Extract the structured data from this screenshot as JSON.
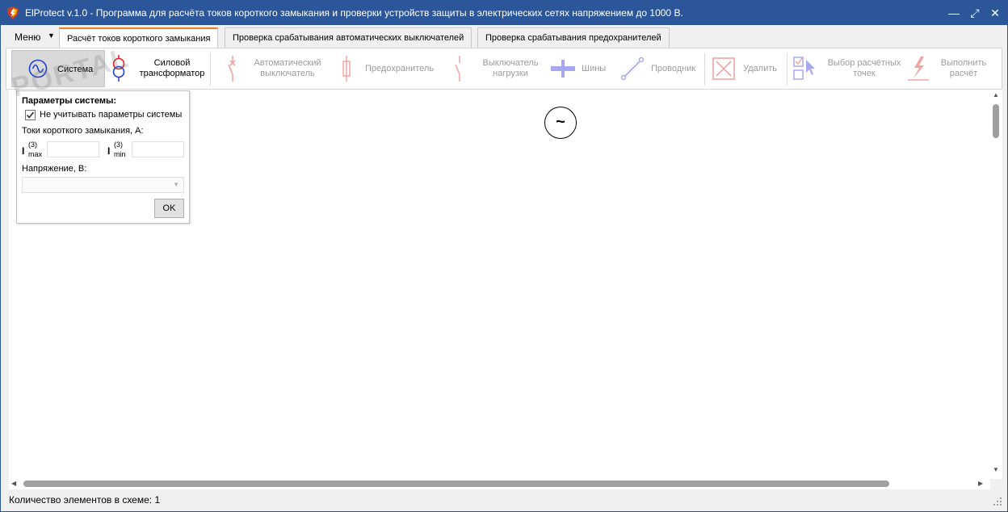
{
  "window": {
    "title": "ElProtect v.1.0 - Программа для расчёта токов короткого замыкания и проверки устройств защиты в электрических сетях напряжением до 1000 В.",
    "controls": {
      "minimize": "—",
      "maximize": "⤢",
      "close": "✕"
    }
  },
  "menu": {
    "label": "Меню",
    "arrow": "▼"
  },
  "tabs": [
    {
      "label": "Расчёт токов короткого замыкания",
      "active": true
    },
    {
      "label": "Проверка срабатывания автоматических выключателей",
      "active": false
    },
    {
      "label": "Проверка срабатывания предохранителей",
      "active": false
    }
  ],
  "ribbon": {
    "system": {
      "label": "Система",
      "icon": "ac-source-icon"
    },
    "transformer": {
      "line1": "Силовой",
      "line2": "трансформатор",
      "icon": "transformer-icon"
    },
    "breaker": {
      "line1": "Автоматический",
      "line2": "выключатель",
      "icon": "circuit-breaker-icon"
    },
    "fuse": {
      "label": "Предохранитель",
      "icon": "fuse-icon"
    },
    "load_switch": {
      "line1": "Выключатель",
      "line2": "нагрузки",
      "icon": "load-switch-icon"
    },
    "busbar": {
      "label": "Шины",
      "icon": "busbar-icon"
    },
    "conductor": {
      "label": "Проводник",
      "icon": "conductor-icon"
    },
    "delete": {
      "label": "Удалить",
      "icon": "delete-icon"
    },
    "select_points": {
      "line1": "Выбор расчётных",
      "line2": "точек",
      "icon": "select-points-icon"
    },
    "run": {
      "line1": "Выполнить",
      "line2": "расчёт",
      "icon": "run-calculation-icon"
    }
  },
  "panel": {
    "header": "Параметры системы:",
    "checkbox_label": "Не учитывать параметры системы",
    "checkbox_checked": true,
    "currents_label": "Токи короткого замыкания, А:",
    "imax_label": "I",
    "imax_sup": "(3)",
    "imax_sub": "max",
    "imin_label": "I",
    "imin_sup": "(3)",
    "imin_sub": "min",
    "imax_value": "",
    "imin_value": "",
    "voltage_label": "Напряжение, В:",
    "voltage_value": "",
    "ok_label": "OK"
  },
  "canvas": {
    "source_symbol": "~"
  },
  "status": {
    "text": "Количество элементов в схеме: 1"
  },
  "watermark": "PORTAL",
  "colors": {
    "titlebar": "#2b579a",
    "tab_accent": "#f07e1e",
    "element_blue": "#1f3fcf",
    "element_red": "#e02020"
  }
}
